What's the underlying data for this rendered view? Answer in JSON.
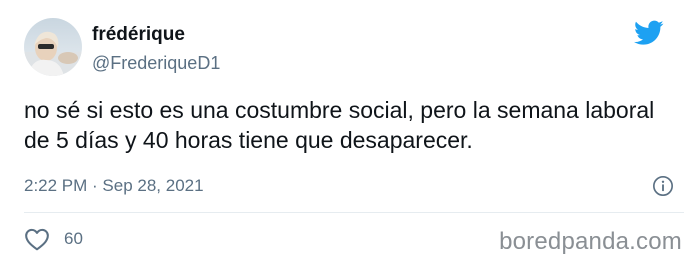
{
  "author": {
    "display_name": "frédérique",
    "handle": "@FrederiqueD1",
    "avatar_icon": "user-avatar"
  },
  "brand": {
    "logo_icon": "twitter-bird-icon",
    "accent_color": "#1da1f2"
  },
  "tweet": {
    "text": "no sé si esto es una costumbre social, pero la semana laboral de 5 días y 40 horas tiene que desaparecer.",
    "timestamp": "2:22 PM · Sep 28, 2021"
  },
  "actions": {
    "like_icon": "heart-outline-icon",
    "like_count": "60",
    "info_icon": "info-circle-icon"
  },
  "watermark": {
    "text": "boredpanda.com"
  },
  "colors": {
    "text_primary": "#0f1419",
    "text_secondary": "#5b7083",
    "divider": "#e6ecf0"
  }
}
